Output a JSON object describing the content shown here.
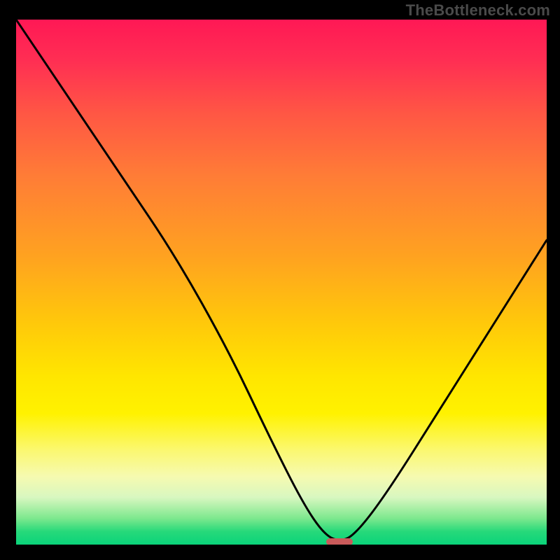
{
  "watermark": "TheBottleneck.com",
  "chart_data": {
    "type": "line",
    "title": "",
    "xlabel": "",
    "ylabel": "",
    "xlim": [
      0,
      100
    ],
    "ylim": [
      0,
      100
    ],
    "grid": false,
    "legend": false,
    "series": [
      {
        "name": "bottleneck-curve",
        "x": [
          0,
          10,
          20,
          30,
          40,
          48,
          54,
          58,
          61,
          64,
          70,
          80,
          90,
          100
        ],
        "y": [
          100,
          85,
          70,
          55,
          37,
          20,
          8,
          2,
          0.5,
          2,
          10,
          26,
          42,
          58
        ]
      }
    ],
    "optimal_marker": {
      "x": 61,
      "y": 0.5,
      "color": "#c95a5a"
    },
    "background_gradient": {
      "stops": [
        {
          "pct": 0,
          "color": "#ff1855"
        },
        {
          "pct": 8,
          "color": "#ff2f53"
        },
        {
          "pct": 18,
          "color": "#ff5744"
        },
        {
          "pct": 30,
          "color": "#ff7d36"
        },
        {
          "pct": 45,
          "color": "#ffa220"
        },
        {
          "pct": 58,
          "color": "#ffc90a"
        },
        {
          "pct": 68,
          "color": "#ffe600"
        },
        {
          "pct": 75,
          "color": "#fff200"
        },
        {
          "pct": 82,
          "color": "#fbf870"
        },
        {
          "pct": 87,
          "color": "#f6fab0"
        },
        {
          "pct": 91,
          "color": "#d8f7c0"
        },
        {
          "pct": 95,
          "color": "#7de88e"
        },
        {
          "pct": 97.5,
          "color": "#27d97a"
        },
        {
          "pct": 100,
          "color": "#0ad37a"
        }
      ]
    }
  }
}
